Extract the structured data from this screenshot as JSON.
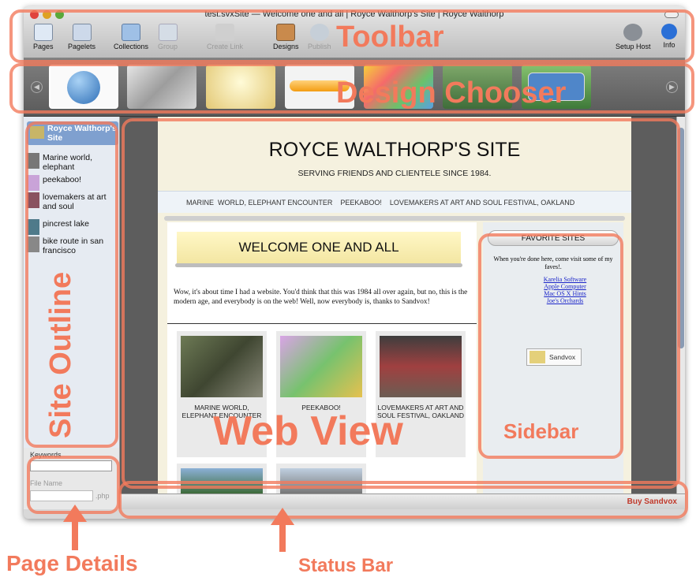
{
  "window": {
    "title": "test.svxSite — Welcome one and all | Royce Walthorp's Site | Royce Walthorp"
  },
  "toolbar": {
    "items": [
      "Pages",
      "Pagelets",
      "Collections",
      "Group",
      "Create Link",
      "Designs",
      "Publish",
      "Setup Host",
      "Info"
    ]
  },
  "outline": {
    "root": "Royce Walthorp's Site",
    "items": [
      "Marine world, elephant",
      "peekaboo!",
      "lovemakers at art and soul",
      "pincrest lake",
      "bike route in san francisco"
    ]
  },
  "details": {
    "keywords_label": "Keywords",
    "filename_label": "File Name",
    "ext": ".php"
  },
  "site": {
    "title": "ROYCE WALTHORP'S SITE",
    "tagline": "SERVING FRIENDS AND CLIENTELE SINCE 1984.",
    "nav": "MARINE  WORLD, ELEPHANT ENCOUNTER    PEEKABOO!    LOVEMAKERS AT ART AND SOUL FESTIVAL, OAKLAND",
    "heading": "WELCOME ONE AND ALL",
    "body": "Wow, it's about time I had a website.  You'd think that this was 1984 all over again, but no, this is the modern age, and everybody is on the web!  Well, now everybody is, thanks to Sandvox!",
    "photos": [
      "MARINE  WORLD, ELEPHANT ENCOUNTER",
      "PEEKABOO!",
      "LOVEMAKERS AT ART AND SOUL FESTIVAL, OAKLAND"
    ],
    "sidebar_title": "FAVORITE SITES",
    "sidebar_text": "When you're done here, come visit some of my faves!.",
    "links": [
      "Karelia Software",
      "Apple Computer",
      "Mac OS X Hints",
      "Joe's Orchards"
    ],
    "badge": "Sandvox"
  },
  "status": {
    "buy": "Buy Sandvox"
  },
  "annotations": {
    "toolbar": "Toolbar",
    "design": "Design Chooser",
    "outline": "Site Outline",
    "web": "Web View",
    "sidebar": "Sidebar",
    "details": "Page Details",
    "statusbar": "Status Bar"
  }
}
